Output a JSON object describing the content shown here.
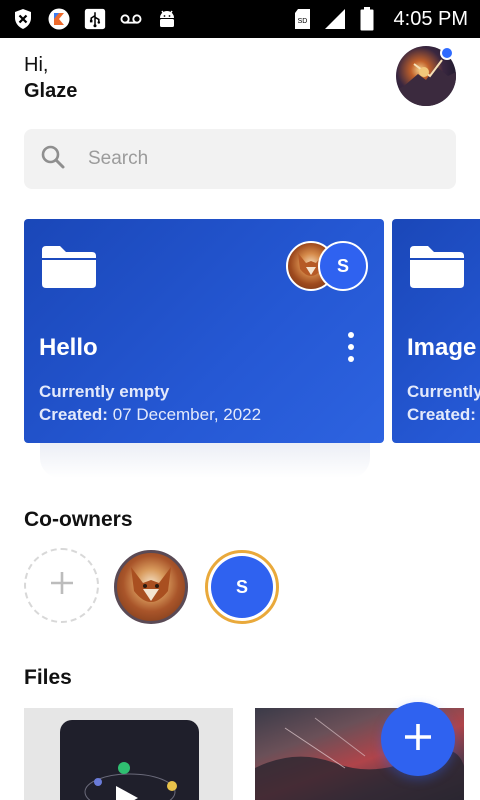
{
  "status_bar": {
    "time": "4:05 PM",
    "sd_label": "SD",
    "icons": [
      "shield-x-icon",
      "kotlin-app-icon",
      "usb-icon",
      "voicemail-icon",
      "android-icon",
      "sd-card-icon",
      "signal-icon",
      "battery-icon"
    ]
  },
  "header": {
    "greeting": "Hi,",
    "user_name": "Glaze"
  },
  "search": {
    "placeholder": "Search"
  },
  "folders": [
    {
      "title": "Hello",
      "status": "Currently empty",
      "created_label": "Created:",
      "created_date": "07 December, 2022",
      "member_initial": "S"
    },
    {
      "title": "Image",
      "status": "Currently",
      "created_label": "Created:"
    }
  ],
  "co_owners": {
    "title": "Co-owners",
    "second_initial": "S"
  },
  "files": {
    "title": "Files"
  },
  "colors": {
    "accent": "#2f62f0",
    "card_gradient_start": "#1a47b8",
    "card_gradient_end": "#2d63e0",
    "ring_orange": "#e9a93b"
  }
}
